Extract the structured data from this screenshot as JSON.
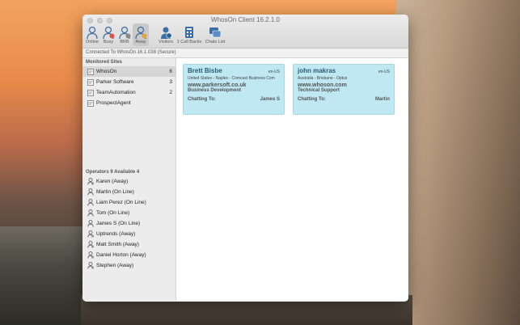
{
  "window": {
    "title": "WhosOn Client 16.2.1.0",
    "connection_status": "Connected To WhosOn 16.1.038 (Secure)"
  },
  "toolbar": {
    "online": "Online",
    "busy": "Busy",
    "brb": "BRB",
    "away": "Away",
    "visitors": "Visitors",
    "callbacks": "1 Call Backs",
    "chats_list": "Chats List"
  },
  "sites": {
    "heading": "Monitored Sites",
    "items": [
      {
        "name": "WhosOn",
        "count": "6"
      },
      {
        "name": "Parker Software",
        "count": "3"
      },
      {
        "name": "TeamAutomation",
        "count": "2"
      },
      {
        "name": "ProspectAgent",
        "count": ""
      }
    ]
  },
  "operators": {
    "heading": "Operators 9 Available 4",
    "items": [
      {
        "name": "Karen (Away)",
        "status": "away"
      },
      {
        "name": "Martin (On Line)",
        "status": "online"
      },
      {
        "name": "Liam Perez (On Line)",
        "status": "online"
      },
      {
        "name": "Tom (On Line)",
        "status": "online"
      },
      {
        "name": "James S (On Line)",
        "status": "online"
      },
      {
        "name": "Uptrends (Away)",
        "status": "away"
      },
      {
        "name": "Matt Smith (Away)",
        "status": "away"
      },
      {
        "name": "Daniel Horton (Away)",
        "status": "away"
      },
      {
        "name": "Stephen (Away)",
        "status": "away"
      }
    ]
  },
  "chats": [
    {
      "name": "Brett Bisbe",
      "lang": "en-US",
      "location": "United States - Naples - Comcast Business Com",
      "site": "www.parkersoft.co.uk",
      "dept": "Business Development",
      "chatting_label": "Chatting To:",
      "operator": "James S"
    },
    {
      "name": "john makras",
      "lang": "en-US",
      "location": "Australia - Brisbane - Optus",
      "site": "www.whoson.com",
      "dept": "Technical Support",
      "chatting_label": "Chatting To:",
      "operator": "Martin"
    }
  ],
  "colors": {
    "card_bg": "#bfe8f2",
    "card_name": "#2a5c74",
    "icon_blue": "#3a6ea5",
    "away_badge": "#e8a33a"
  }
}
